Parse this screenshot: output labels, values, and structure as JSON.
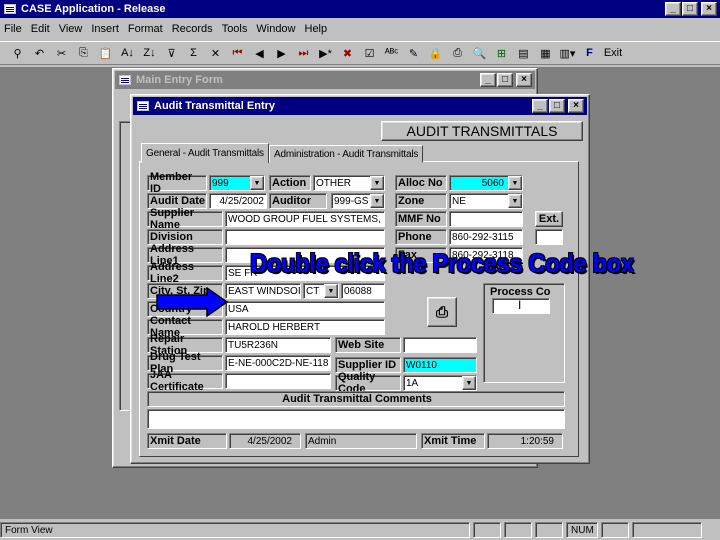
{
  "app": {
    "title": "CASE Application - Release"
  },
  "menu": [
    "File",
    "Edit",
    "View",
    "Insert",
    "Format",
    "Records",
    "Tools",
    "Window",
    "Help"
  ],
  "toolbar": {
    "exit_label": "Exit"
  },
  "main_form": {
    "title": "Main Entry Form"
  },
  "audit_window": {
    "title": "Audit Transmittal Entry",
    "header": "AUDIT TRANSMITTALS",
    "tabs": [
      "General - Audit Transmittals",
      "Administration - Audit Transmittals"
    ]
  },
  "form": {
    "member_id_label": "Member ID",
    "member_id": "999",
    "action_label": "Action",
    "action": "OTHER",
    "alloc_no_label": "Alloc No",
    "alloc_no": "5060",
    "audit_date_label": "Audit Date",
    "audit_date": "4/25/2002",
    "auditor_label": "Auditor",
    "auditor": "999-GS",
    "zone_label": "Zone",
    "zone": "NE",
    "supplier_name_label": "Supplier Name",
    "supplier_name": "WOOD GROUP FUEL SYSTEMS, I",
    "mmf_no_label": "MMF No",
    "mmf_no": "",
    "ext_label": "Ext.",
    "division_label": "Division",
    "division": "",
    "phone_label": "Phone",
    "phone": "860-292-3115",
    "address1_label": "Address Line1",
    "address1": "",
    "fax_label": "Fax",
    "fax": "860-292-3118",
    "address2_label": "Address Line2",
    "address2": "SE FR",
    "city_label": "City, St, Zip",
    "city": "EAST WINDSOI",
    "state": "CT",
    "zip": "06088",
    "country_label": "Country",
    "country": "USA",
    "contact_label": "Contact Name",
    "contact": "HAROLD HERBERT",
    "repair_label": "Repair Station",
    "repair": "TU5R236N",
    "website_label": "Web Site",
    "website": "",
    "drugtest_label": "Drug Test Plan",
    "drugtest": "E-NE-000C2D-NE-118",
    "supplier_id_label": "Supplier ID",
    "supplier_id": "W0110",
    "jaa_label": "JAA Certificate",
    "jaa": "",
    "quality_label": "Quality Code",
    "quality": "1A",
    "process_code_label": "Process Co",
    "process_code": "",
    "comments_label": "Audit Transmittal Comments",
    "comments": "",
    "xmit_date_label": "Xmit Date",
    "xmit_date": "4/25/2002",
    "xmit_by": "Admin",
    "xmit_time_label": "Xmit Time",
    "xmit_time": "1:20:59"
  },
  "overlay": {
    "text": "Double click the Process Code box"
  },
  "status": {
    "view": "Form View",
    "num": "NUM"
  }
}
